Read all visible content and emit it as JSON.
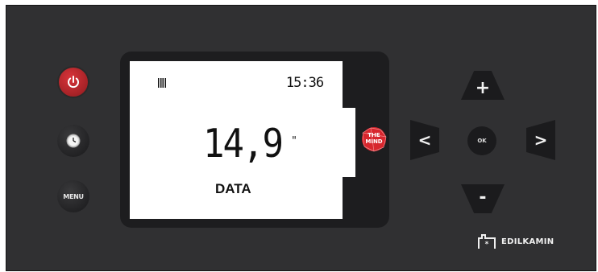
{
  "controls": {
    "power": {
      "icon": "power-icon",
      "color": "#c0262c"
    },
    "clock": {
      "icon": "clock-icon"
    },
    "menu": {
      "label": "MENU"
    }
  },
  "display": {
    "time": "15:36",
    "value": "14,9",
    "value_suffix": "\"",
    "label": "DATA",
    "left_icon": "bars-icon"
  },
  "mind_logo": {
    "line1": "THE",
    "line2": "MIND",
    "color": "#d7262d"
  },
  "navigation": {
    "plus": "+",
    "minus": "-",
    "left": "<",
    "right": ">",
    "ok": "OK"
  },
  "brand": {
    "name": "EDILKAMIN",
    "icon": "edilkamin-logo-icon"
  }
}
